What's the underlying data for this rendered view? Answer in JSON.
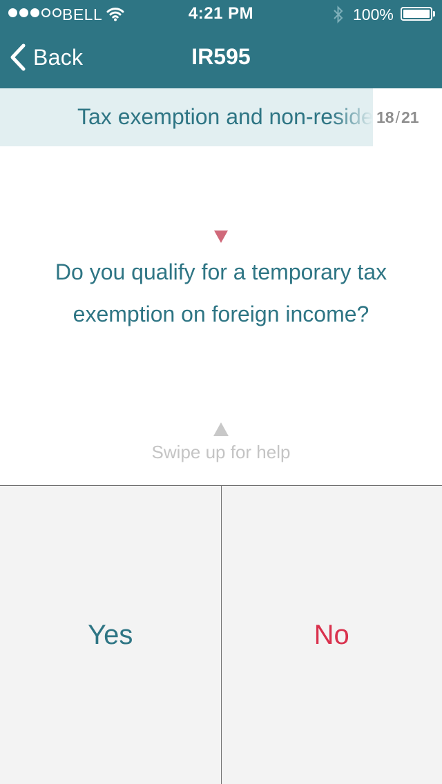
{
  "status_bar": {
    "carrier": "BELL",
    "signal_bars_total": 5,
    "signal_bars_filled": 3,
    "time": "4:21 PM",
    "battery_percent": "100%",
    "battery_level": 1.0,
    "icons": [
      "wifi-icon",
      "bluetooth-icon",
      "battery-icon"
    ]
  },
  "nav": {
    "back_label": "Back",
    "title": "IR595"
  },
  "section": {
    "title": "Tax exemption and non-resident",
    "current": "18",
    "separator": "/",
    "total": "21"
  },
  "question": {
    "text": "Do you qualify for a temporary tax exemption on foreign income?"
  },
  "help": {
    "label": "Swipe up for help"
  },
  "answers": {
    "yes_label": "Yes",
    "no_label": "No"
  },
  "colors": {
    "accent": "#2e7584",
    "section_band": "#e2eff1",
    "marker": "#d0697a",
    "no": "#d9314d",
    "answer_bg": "#f3f3f3",
    "hint": "#c4c4c4"
  }
}
